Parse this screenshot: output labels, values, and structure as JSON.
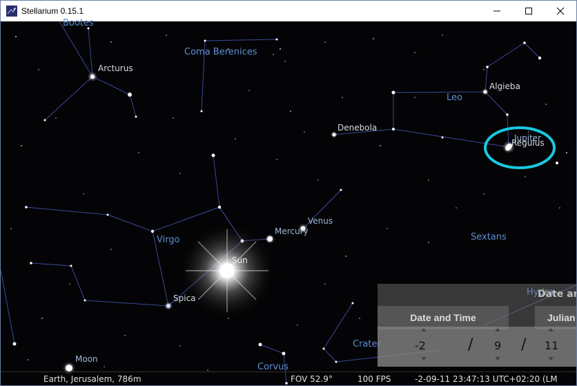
{
  "window": {
    "title": "Stellarium 0.15.1"
  },
  "labels": {
    "bootes": "Bootes",
    "coma": "Coma Berenices",
    "arcturus": "Arcturus",
    "leo": "Leo",
    "algieba": "Algieba",
    "denebola": "Denebola",
    "jupiter": "Jupiter",
    "regulus": "Regulus",
    "virgo": "Virgo",
    "mercury": "Mercury",
    "venus": "Venus",
    "sextans": "Sextans",
    "sun": "Sun",
    "spica": "Spica",
    "hydra": "Hydra",
    "crater": "Crater",
    "moon": "Moon",
    "corvus": "Corvus"
  },
  "date_time_panel": {
    "tab_date_time": "Date and Time",
    "tab_julian": "Julian",
    "tab_partial_hidden": "Date an",
    "year": "-2",
    "sep1": "/",
    "month": "9",
    "sep2": "/",
    "day": "11"
  },
  "status_bar": {
    "location": "Earth, Jerusalem, 786m",
    "fov": "FOV 52.9°",
    "fps": "100 FPS",
    "datetime": "-2-09-11 23:47:13 UTC+02:20 (LM"
  },
  "colors": {
    "constellation_line": "#3b4a9a",
    "constellation_label": "#5f8fd6",
    "highlight_circle": "#18c8e0"
  }
}
